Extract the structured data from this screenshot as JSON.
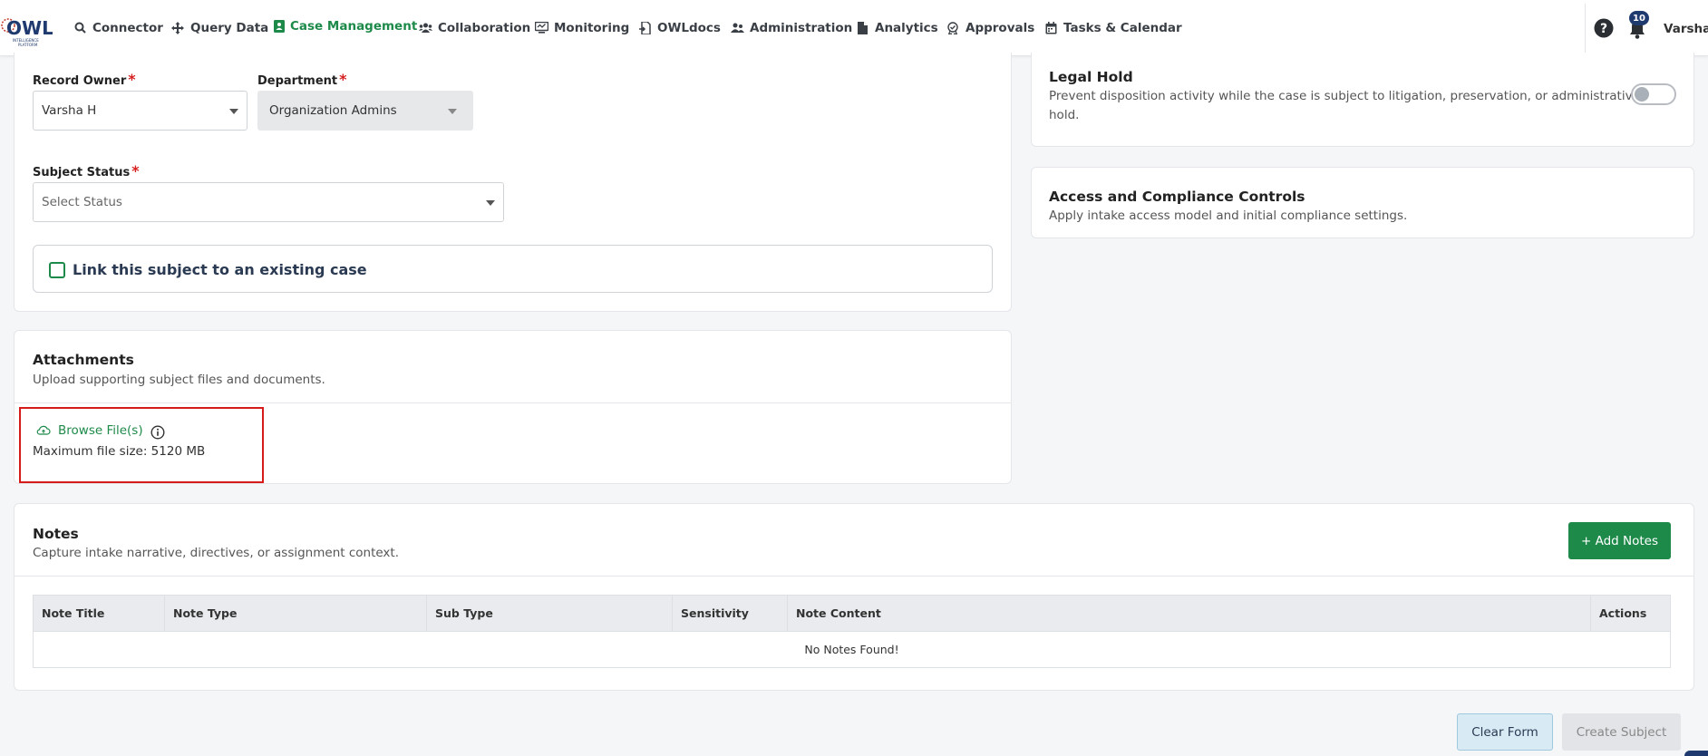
{
  "brand": {
    "logo_text": "OWL",
    "logo_sub": "INTELLIGENCE PLATFORM",
    "accent": "#1e8a4a",
    "danger": "#d61f1f",
    "navy": "#1f3a6e"
  },
  "nav": {
    "items": [
      {
        "label": "Connector",
        "icon": "search-icon"
      },
      {
        "label": "Query Data",
        "icon": "move-icon"
      },
      {
        "label": "Case Management",
        "icon": "contact-book-icon",
        "active": true
      },
      {
        "label": "Collaboration",
        "icon": "users-icon"
      },
      {
        "label": "Monitoring",
        "icon": "monitor-icon"
      },
      {
        "label": "OWLdocs",
        "icon": "doc-share-icon"
      },
      {
        "label": "Administration",
        "icon": "admin-users-icon"
      },
      {
        "label": "Analytics",
        "icon": "file-icon"
      },
      {
        "label": "Approvals",
        "icon": "approval-icon"
      },
      {
        "label": "Tasks & Calendar",
        "icon": "calendar-icon"
      }
    ],
    "notifications_count": "10",
    "user": "Varsha H"
  },
  "form": {
    "record_owner_label": "Record Owner",
    "record_owner_value": "Varsha H",
    "department_label": "Department",
    "department_value": "Organization Admins",
    "subject_status_label": "Subject Status",
    "subject_status_placeholder": "Select Status",
    "required_mark": "*",
    "link_case_label": "Link this subject to an existing case"
  },
  "legal_hold": {
    "title": "Legal Hold",
    "desc_line1": "Prevent disposition activity while the case is subject to litigation, preservation, or administrative",
    "desc_line2": "hold.",
    "enabled": false
  },
  "access": {
    "title": "Access and Compliance Controls",
    "desc": "Apply intake access model and initial compliance settings."
  },
  "attachments": {
    "title": "Attachments",
    "desc": "Upload supporting subject files and documents.",
    "browse_label": "Browse File(s)",
    "max_size": "Maximum file size: 5120 MB"
  },
  "notes": {
    "title": "Notes",
    "desc": "Capture intake narrative, directives, or assignment context.",
    "add_label": "+ Add Notes",
    "columns": [
      "Note Title",
      "Note Type",
      "Sub Type",
      "Sensitivity",
      "Note Content",
      "Actions"
    ],
    "empty": "No Notes Found!"
  },
  "footer": {
    "clear_label": "Clear Form",
    "create_label": "Create Subject"
  }
}
